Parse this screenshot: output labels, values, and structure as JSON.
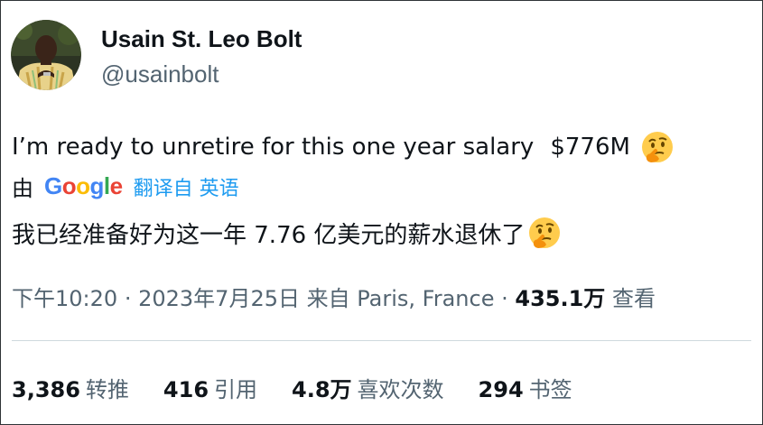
{
  "author": {
    "name": "Usain St. Leo Bolt",
    "handle": "@usainbolt",
    "avatar_icon": "profile-photo"
  },
  "tweet": {
    "text": "I’m ready to unretire for this one year salary",
    "amount": "$776M",
    "emoji": "thinking-face-emoji"
  },
  "translation": {
    "by_label": "由",
    "provider": "Google",
    "link_label": "翻译自 英语",
    "text": "我已经准备好为这一年 7.76 亿美元的薪水退休了"
  },
  "meta": {
    "time": "下午10:20",
    "separator": "·",
    "date": "2023年7月25日",
    "source": "来自 Paris, France",
    "views_count": "435.1万",
    "views_label": "查看"
  },
  "stats": {
    "retweets_count": "3,386",
    "retweets_label": "转推",
    "quotes_count": "416",
    "quotes_label": "引用",
    "likes_count": "4.8万",
    "likes_label": "喜欢次数",
    "bookmarks_count": "294",
    "bookmarks_label": "书签"
  },
  "colors": {
    "primary_text": "#0f1419",
    "secondary_text": "#536471",
    "link": "#1d9bf0",
    "google_blue": "#4285f4",
    "google_red": "#ea4335",
    "google_yellow": "#fbbc05",
    "google_green": "#34a853"
  }
}
